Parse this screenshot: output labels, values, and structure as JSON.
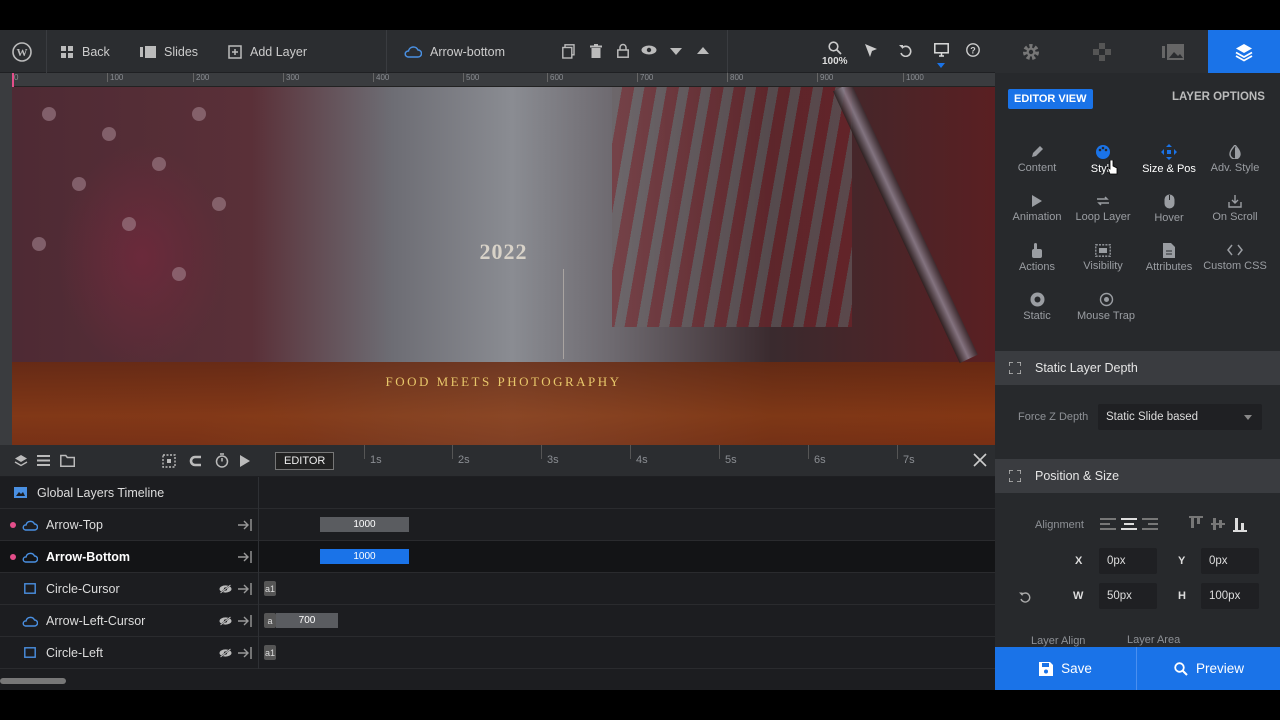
{
  "topbar": {
    "back_label": "Back",
    "slides_label": "Slides",
    "add_layer_label": "Add Layer",
    "current_layer": "Arrow-bottom",
    "zoom": "100%"
  },
  "ruler": {
    "ticks": [
      "0",
      "100",
      "200",
      "300",
      "400",
      "500",
      "600",
      "700",
      "800",
      "900",
      "1000"
    ]
  },
  "canvas": {
    "year": "2022",
    "tagline": "FOOD MEETS PHOTOGRAPHY"
  },
  "timeline": {
    "editor_label": "EDITOR",
    "seconds": [
      "1s",
      "2s",
      "3s",
      "4s",
      "5s",
      "6s",
      "7s"
    ],
    "global_label": "Global Layers Timeline",
    "layers": [
      {
        "name": "Arrow-Top",
        "bar": "1000",
        "a": ""
      },
      {
        "name": "Arrow-Bottom",
        "bar": "1000",
        "a": ""
      },
      {
        "name": "Circle-Cursor",
        "bar": "",
        "a": "a1"
      },
      {
        "name": "Arrow-Left-Cursor",
        "bar": "700",
        "a": "a"
      },
      {
        "name": "Circle-Left",
        "bar": "",
        "a": "a1"
      }
    ]
  },
  "panel": {
    "editor_view": "EDITOR VIEW",
    "layer_options": "LAYER OPTIONS",
    "options": [
      "Content",
      "Style",
      "Size & Pos",
      "Adv. Style",
      "Animation",
      "Loop Layer",
      "Hover",
      "On Scroll",
      "Actions",
      "Visibility",
      "Attributes",
      "Custom CSS",
      "Static",
      "Mouse Trap"
    ],
    "static_depth": {
      "title": "Static Layer Depth",
      "force_z_label": "Force Z Depth",
      "force_z_value": "Static Slide based"
    },
    "position_size": {
      "title": "Position & Size",
      "alignment_label": "Alignment",
      "x_label": "X",
      "x_value": "0px",
      "y_label": "Y",
      "y_value": "0px",
      "w_label": "W",
      "w_value": "50px",
      "h_label": "H",
      "h_value": "100px",
      "layer_align_label": "Layer Align",
      "layer_area_label": "Layer Area"
    },
    "save_label": "Save",
    "preview_label": "Preview"
  },
  "colors": {
    "accent": "#1a73e8",
    "tagline": "#e8c76a",
    "marker": "#e44e8a"
  }
}
